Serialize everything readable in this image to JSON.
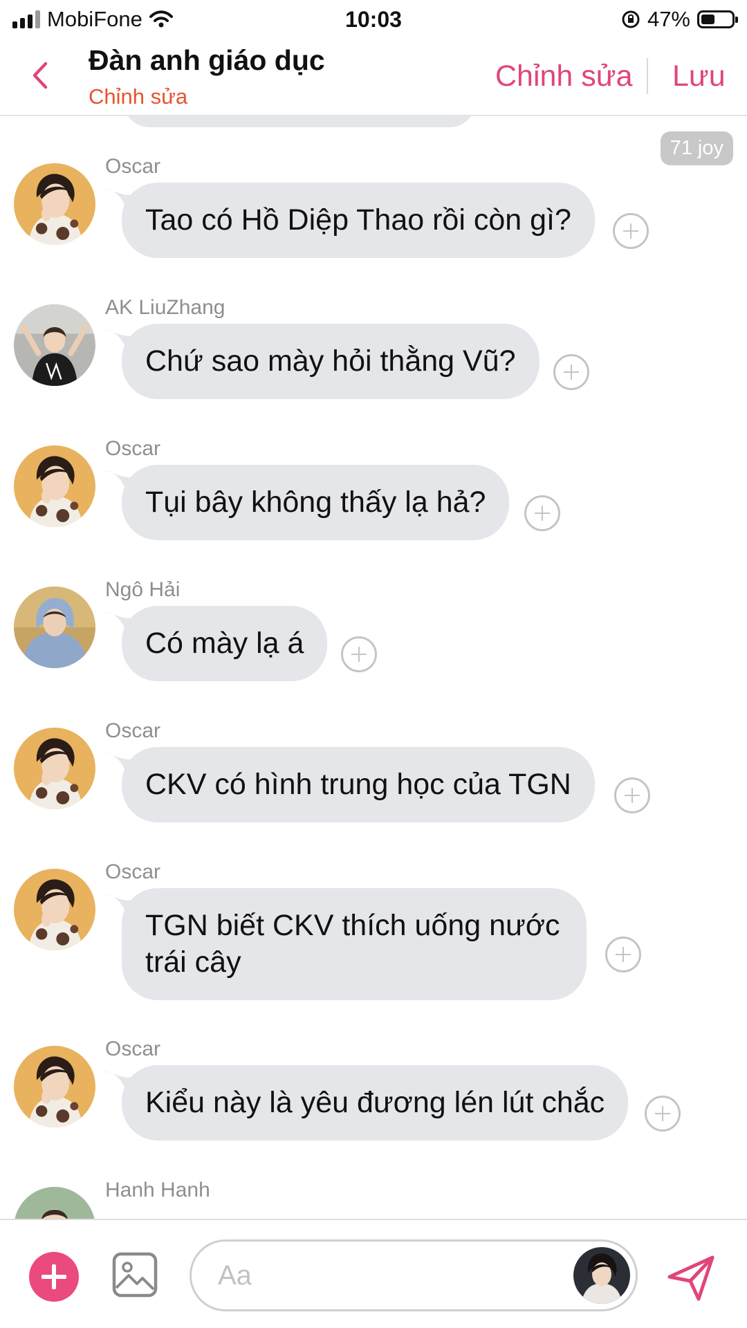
{
  "status_bar": {
    "carrier": "MobiFone",
    "time": "10:03",
    "battery_percent": "47%",
    "battery_level": 0.47,
    "signal_bars_active": 3,
    "icons": [
      "signal-icon",
      "wifi-icon",
      "orientation-lock-icon",
      "battery-icon"
    ]
  },
  "header": {
    "title": "Đàn anh giáo dục",
    "subtitle": "Chỉnh sửa",
    "edit_label": "Chỉnh sửa",
    "save_label": "Lưu",
    "back_icon": "chevron-left-icon"
  },
  "chat": {
    "joy_badge": "71 joy",
    "messages": [
      {
        "sender": "Oscar",
        "text": "Tao có Hồ Diệp Thao rồi còn gì?",
        "avatar": "oscar"
      },
      {
        "sender": "AK LiuZhang",
        "text": "Chứ sao mày hỏi thằng Vũ?",
        "avatar": "ak"
      },
      {
        "sender": "Oscar",
        "text": "Tụi bây không thấy lạ hả?",
        "avatar": "oscar"
      },
      {
        "sender": "Ngô Hải",
        "text": "Có mày lạ á",
        "avatar": "ngohai"
      },
      {
        "sender": "Oscar",
        "text": "CKV có hình trung học của TGN",
        "avatar": "oscar"
      },
      {
        "sender": "Oscar",
        "text": "TGN biết CKV thích uống nước trái cây",
        "avatar": "oscar"
      },
      {
        "sender": "Oscar",
        "text": "Kiểu này là yêu đương lén lút chắc",
        "avatar": "oscar"
      },
      {
        "sender": "Hanh Hanh",
        "text": "",
        "avatar": "hanh"
      }
    ]
  },
  "composer": {
    "placeholder": "Aa",
    "value": "",
    "add_icon": "plus-icon",
    "image_icon": "image-icon",
    "send_icon": "send-icon"
  },
  "colors": {
    "accent": "#e0457b",
    "subtitle": "#e8532e",
    "bubble": "#e5e6ea",
    "add_button": "#ea4a7c"
  }
}
